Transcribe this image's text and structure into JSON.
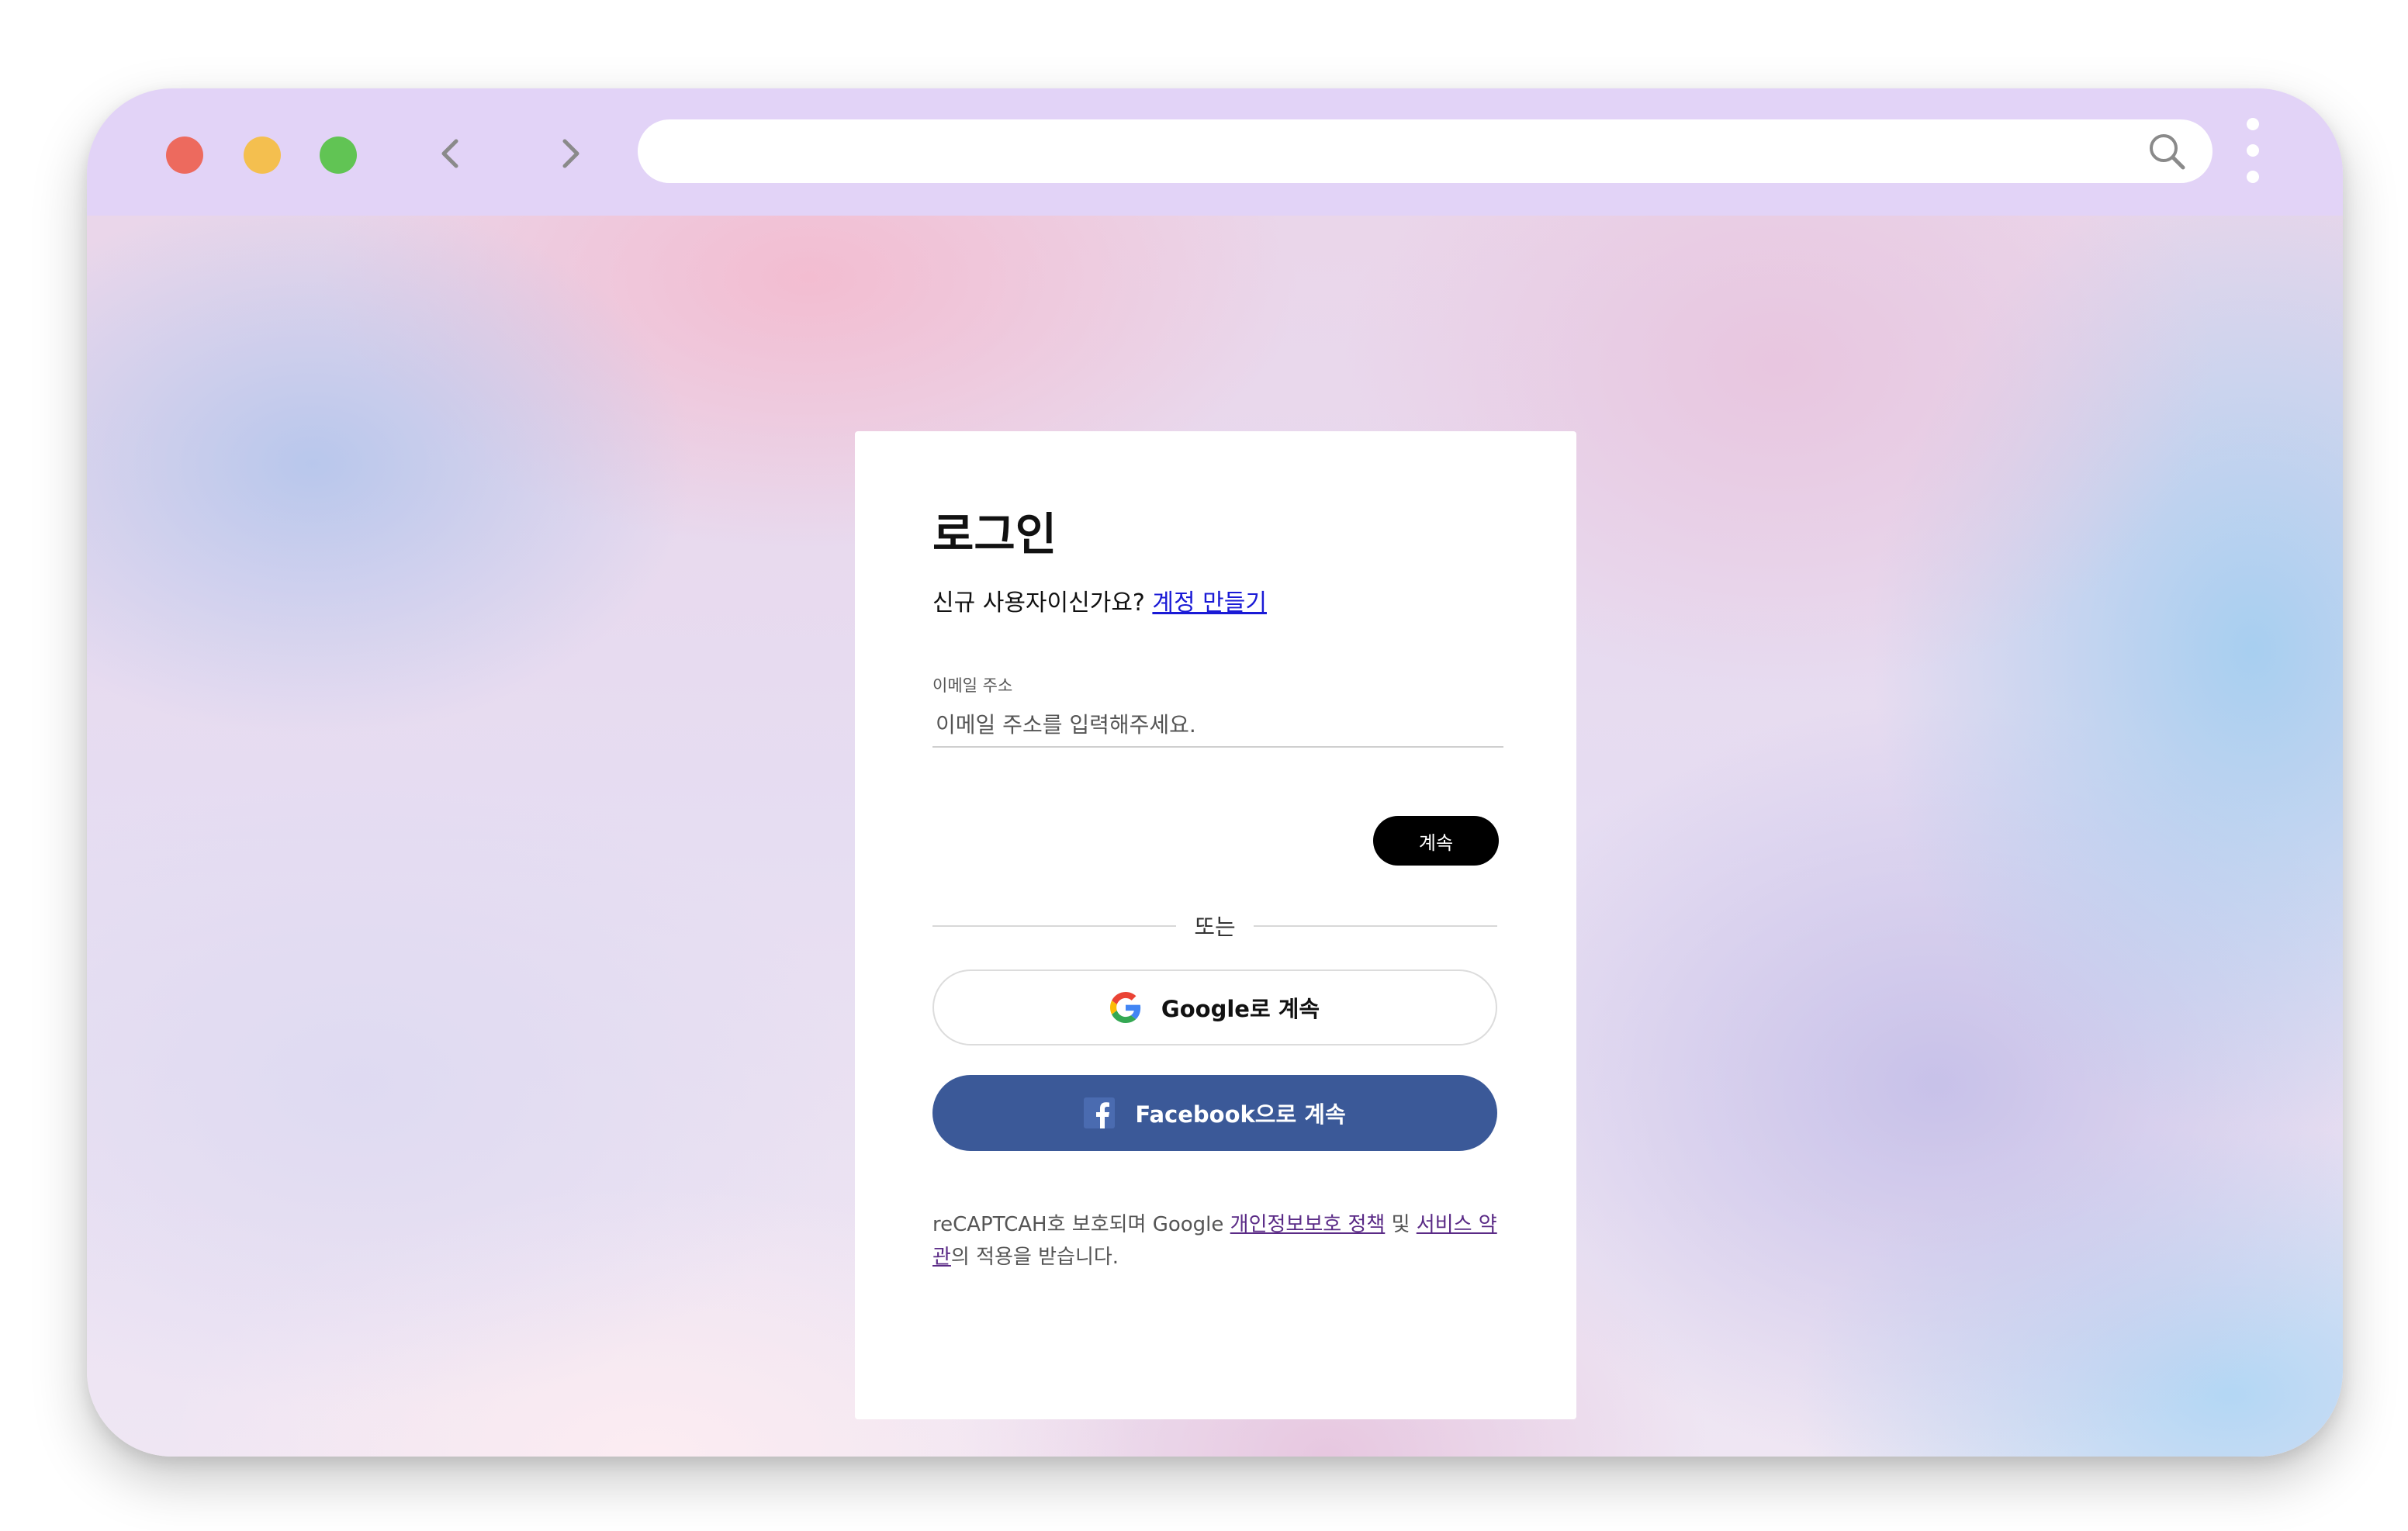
{
  "browser": {
    "traffic_lights": [
      "close",
      "minimize",
      "maximize"
    ],
    "url": "",
    "icons": [
      "back-icon",
      "forward-icon",
      "search-icon",
      "more-vertical-icon"
    ],
    "colors": {
      "titlebar": "#e2d3f7",
      "close": "#ed6a5e",
      "minimize": "#f4bf4f",
      "maximize": "#61c454"
    }
  },
  "login": {
    "title": "로그인",
    "new_user_prompt": "신규 사용자이신가요?",
    "create_account_link": "계정 만들기",
    "email_label": "이메일 주소",
    "email_placeholder": "이메일 주소를 입력해주세요.",
    "continue_label": "계속",
    "divider_text": "또는",
    "google_button_label": "Google로 계속",
    "facebook_button_label": "Facebook으로 계속",
    "legal": {
      "prefix": "reCAPTCAH호 보호되며 Google",
      "privacy_link": "개인정보보호 정책",
      "and": "및",
      "terms_link": "서비스 약관",
      "suffix": "의 적용을 받습니다."
    },
    "colors": {
      "continue_button": "#000000",
      "facebook": "#3b5998",
      "link": "#1a1ad6"
    }
  }
}
